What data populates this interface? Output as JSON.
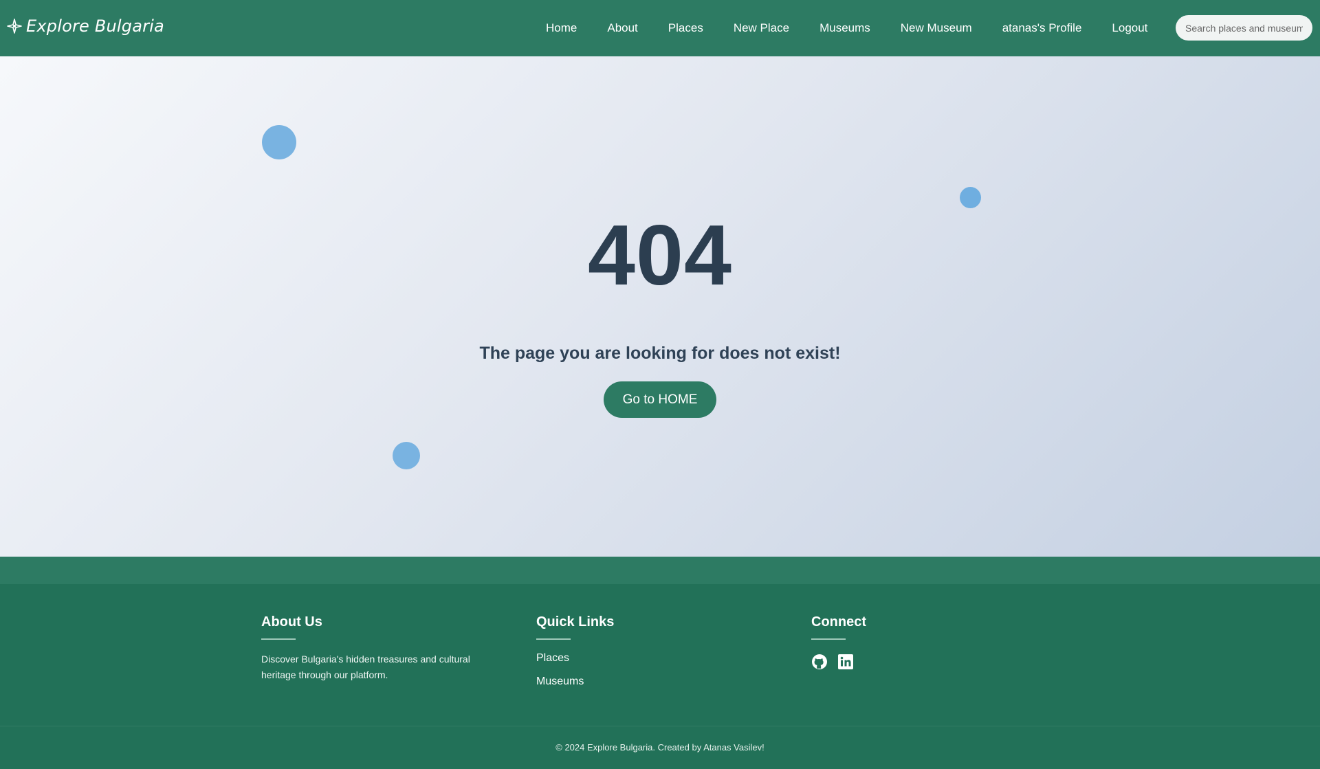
{
  "brand": {
    "name": "Explore Bulgaria",
    "icon": "compass-star-icon"
  },
  "nav": {
    "links": [
      {
        "label": "Home"
      },
      {
        "label": "About"
      },
      {
        "label": "Places"
      },
      {
        "label": "New Place"
      },
      {
        "label": "Museums"
      },
      {
        "label": "New Museum"
      },
      {
        "label": "atanas's Profile"
      },
      {
        "label": "Logout"
      }
    ],
    "search_placeholder": "Search places and museums..."
  },
  "error": {
    "code": "404",
    "message": "The page you are looking for does not exist!",
    "button_label": "Go to HOME"
  },
  "footer": {
    "about": {
      "title": "About Us",
      "text": "Discover Bulgaria's hidden treasures and cultural heritage through our platform."
    },
    "quick_links": {
      "title": "Quick Links",
      "items": [
        {
          "label": "Places"
        },
        {
          "label": "Museums"
        }
      ]
    },
    "connect": {
      "title": "Connect",
      "icons": [
        "github-icon",
        "linkedin-icon"
      ]
    },
    "copyright": "© 2024 Explore Bulgaria. Created by Atanas Vasilev!"
  },
  "colors": {
    "primary": "#2d7b63",
    "footer": "#227158",
    "heading": "#2c3e50",
    "bubble": "#79b3e1"
  }
}
